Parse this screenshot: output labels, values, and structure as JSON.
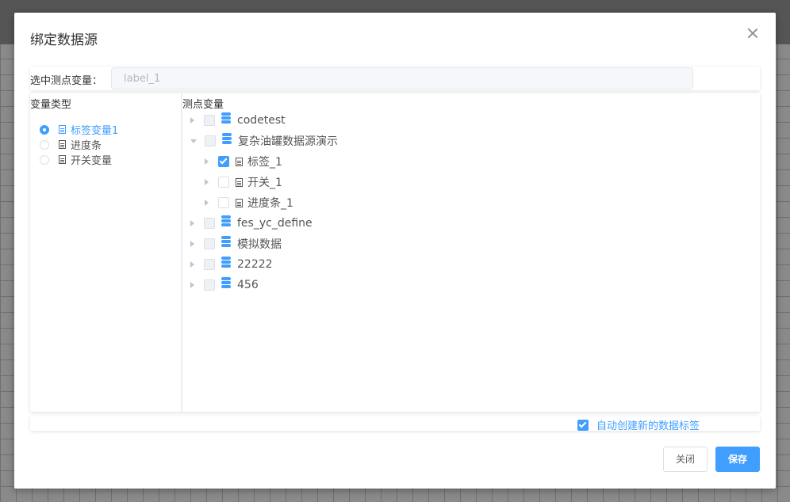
{
  "dialog": {
    "title": "绑定数据源"
  },
  "selected": {
    "label": "选中测点变量：",
    "value": "label_1"
  },
  "left": {
    "header": "变量类型",
    "options": [
      {
        "label": "标签变量1",
        "checked": true
      },
      {
        "label": "进度条",
        "checked": false
      },
      {
        "label": "开关变量",
        "checked": false
      }
    ]
  },
  "right": {
    "header": "测点变量",
    "tree": [
      {
        "label": "codetest",
        "type": "database",
        "expanded": false
      },
      {
        "label": "复杂油罐数据源演示",
        "type": "database",
        "expanded": true
      },
      {
        "label": "标签_1",
        "type": "variable",
        "checked": true
      },
      {
        "label": "开关_1",
        "type": "variable",
        "checked": false
      },
      {
        "label": "进度条_1",
        "type": "variable",
        "checked": false
      },
      {
        "label": "fes_yc_define",
        "type": "database",
        "expanded": false
      },
      {
        "label": "模拟数据",
        "type": "database",
        "expanded": false
      },
      {
        "label": "22222",
        "type": "database",
        "expanded": false
      },
      {
        "label": "456",
        "type": "database",
        "expanded": false
      }
    ]
  },
  "auto": {
    "label": "自动创建新的数据标签",
    "checked": true
  },
  "buttons": {
    "close": "关闭",
    "save": "保存"
  },
  "colors": {
    "accent": "#409eff"
  }
}
